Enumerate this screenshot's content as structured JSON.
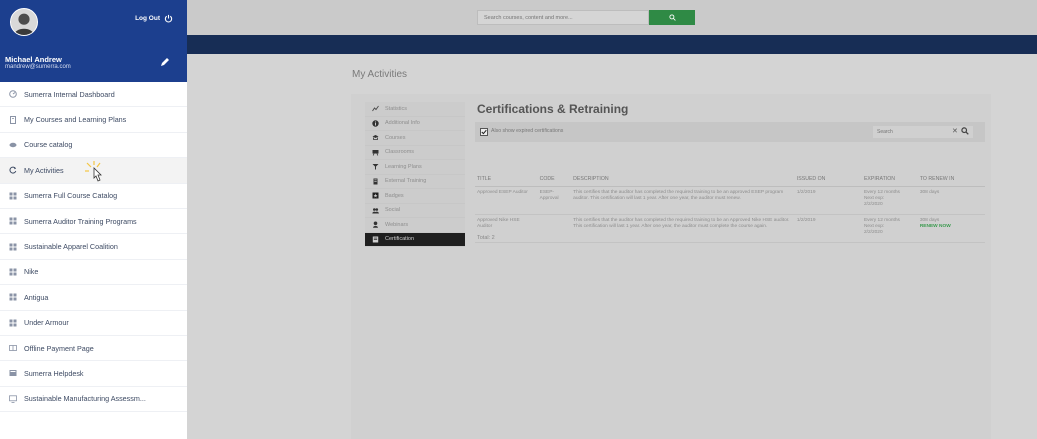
{
  "user": {
    "name": "Michael Andrew",
    "email": "mandrew@sumerra.com",
    "logout_label": "Log Out"
  },
  "topbar": {
    "search_placeholder": "Search courses, content and more...",
    "accent_color": "#2f8a45"
  },
  "sidebar": {
    "items": [
      {
        "label": "Sumerra Internal Dashboard",
        "icon": "dashboard-icon"
      },
      {
        "label": "My Courses and Learning Plans",
        "icon": "book-icon"
      },
      {
        "label": "Course catalog",
        "icon": "catalog-icon"
      },
      {
        "label": "My Activities",
        "icon": "activities-icon"
      },
      {
        "label": "Sumerra Full Course Catalog",
        "icon": "grid-icon"
      },
      {
        "label": "Sumerra Auditor Training Programs",
        "icon": "grid-icon"
      },
      {
        "label": "Sustainable Apparel Coalition",
        "icon": "grid-icon"
      },
      {
        "label": "Nike",
        "icon": "grid-icon"
      },
      {
        "label": "Antigua",
        "icon": "grid-icon"
      },
      {
        "label": "Under Armour",
        "icon": "grid-icon"
      },
      {
        "label": "Offline Payment Page",
        "icon": "payment-icon"
      },
      {
        "label": "Sumerra Helpdesk",
        "icon": "helpdesk-icon"
      },
      {
        "label": "Sustainable Manufacturing Assessm...",
        "icon": "monitor-icon"
      }
    ]
  },
  "page": {
    "title": "My Activities"
  },
  "subnav": {
    "items": [
      {
        "label": "Statistics",
        "icon": "chart-icon"
      },
      {
        "label": "Additional Info",
        "icon": "info-icon"
      },
      {
        "label": "Courses",
        "icon": "courses-icon"
      },
      {
        "label": "Classrooms",
        "icon": "classroom-icon"
      },
      {
        "label": "Learning Plans",
        "icon": "learning-plan-icon"
      },
      {
        "label": "External Training",
        "icon": "external-icon"
      },
      {
        "label": "Badges",
        "icon": "badge-icon"
      },
      {
        "label": "Social",
        "icon": "social-icon"
      },
      {
        "label": "Webinars",
        "icon": "webinar-icon"
      },
      {
        "label": "Certification",
        "icon": "certification-icon"
      }
    ]
  },
  "certifications": {
    "title": "Certifications & Retraining",
    "show_expired_label": "Also show expired certifications",
    "search_placeholder": "Search",
    "columns": {
      "title": "TITLE",
      "code": "CODE",
      "description": "DESCRIPTION",
      "issued_on": "ISSUED ON",
      "expiration": "EXPIRATION",
      "to_renew_in": "TO RENEW IN"
    },
    "rows": [
      {
        "title": "Approved ESEP Auditor",
        "code": "ESEP-Approval",
        "description": "This certifies that the auditor has completed the required training to be an approved ESEP program auditor. This certification will last 1 year. After one year, the auditor must renew.",
        "issued_on": "1/2/2019",
        "expiration_freq": "Every 12 months",
        "expiration_next": "Next exp:",
        "expiration_date": "2/2/2020",
        "renew_in": "308 days",
        "renew_link": ""
      },
      {
        "title": "Approved Nike HSE Auditor",
        "code": "",
        "description": "This certifies that the auditor has completed the required training to be an Approved Nike HSE auditor. This certification will last 1 year. After one year, the auditor must complete the course again.",
        "issued_on": "1/2/2019",
        "expiration_freq": "Every 12 months",
        "expiration_next": "Next exp:",
        "expiration_date": "2/2/2020",
        "renew_in": "308 days",
        "renew_link": "RENEW NOW"
      }
    ],
    "total_label": "Total: 2"
  }
}
